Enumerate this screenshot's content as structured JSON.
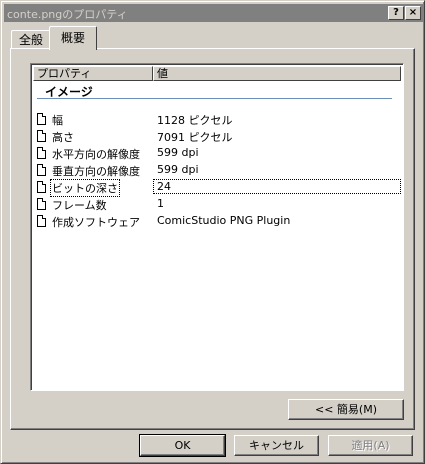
{
  "window": {
    "title": "conte.pngのプロパティ",
    "help_label": "?",
    "close_label": "×"
  },
  "tabs": [
    {
      "label": "全般",
      "active": false
    },
    {
      "label": "概要",
      "active": true
    }
  ],
  "list": {
    "columns": {
      "property": "プロパティ",
      "value": "値"
    },
    "group": "イメージ",
    "rows": [
      {
        "property": "幅",
        "value": "1128 ピクセル"
      },
      {
        "property": "高さ",
        "value": "7091 ピクセル"
      },
      {
        "property": "水平方向の解像度",
        "value": "599 dpi"
      },
      {
        "property": "垂直方向の解像度",
        "value": "599 dpi"
      },
      {
        "property": "ビットの深さ",
        "value": "24"
      },
      {
        "property": "フレーム数",
        "value": "1"
      },
      {
        "property": "作成ソフトウェア",
        "value": "ComicStudio PNG Plugin"
      }
    ],
    "icons": [
      "document-icon"
    ]
  },
  "buttons": {
    "simple": "<< 簡易(M)",
    "ok": "OK",
    "cancel": "キャンセル",
    "apply": "適用(A)"
  }
}
